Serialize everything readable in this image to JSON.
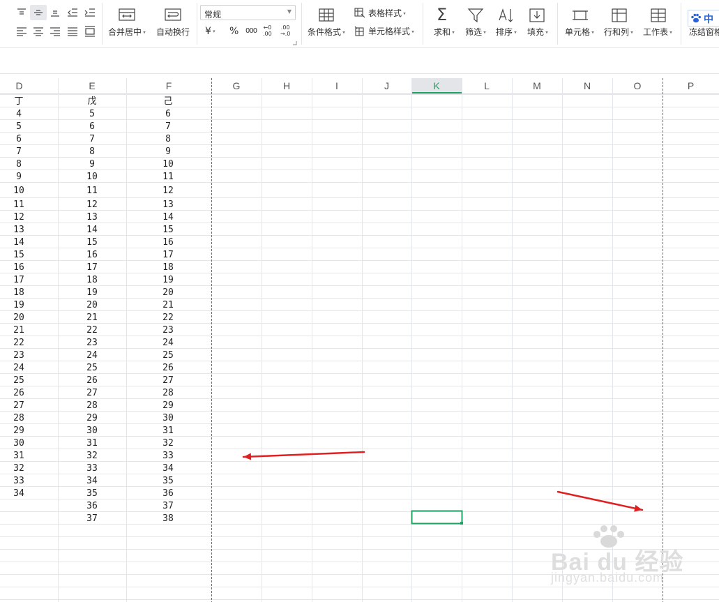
{
  "ribbon": {
    "merge_center": "合并居中",
    "auto_wrap": "自动换行",
    "number_format": "常规",
    "currency": "¥",
    "percent": "%",
    "thousands": "000",
    "decrease_decimal_top": "←0",
    "decrease_decimal_bottom": ".00",
    "increase_decimal_top": ".00",
    "increase_decimal_bottom": "→.0",
    "conditional_format": "条件格式",
    "table_style": "表格样式",
    "cell_style": "单元格样式",
    "sum": "求和",
    "filter": "筛选",
    "sort": "排序",
    "fill": "填充",
    "cell": "单元格",
    "rows_cols": "行和列",
    "worksheet": "工作表",
    "freeze_panes": "冻结窗格",
    "ime_badge": "中"
  },
  "grid": {
    "columns": [
      "D",
      "E",
      "F",
      "G",
      "H",
      "I",
      "J",
      "K",
      "L",
      "M",
      "N",
      "O",
      "P"
    ],
    "selected_column": "K",
    "header_row": [
      "丁",
      "戊",
      "己"
    ],
    "rows": [
      [
        "4",
        "5",
        "6"
      ],
      [
        "5",
        "6",
        "7"
      ],
      [
        "6",
        "7",
        "8"
      ],
      [
        "7",
        "8",
        "9"
      ],
      [
        "8",
        "9",
        "10"
      ],
      [
        "9",
        "10",
        "11"
      ],
      [
        "10",
        "11",
        "12"
      ],
      [
        "11",
        "12",
        "13"
      ],
      [
        "12",
        "13",
        "14"
      ],
      [
        "13",
        "14",
        "15"
      ],
      [
        "14",
        "15",
        "16"
      ],
      [
        "15",
        "16",
        "17"
      ],
      [
        "16",
        "17",
        "18"
      ],
      [
        "17",
        "18",
        "19"
      ],
      [
        "18",
        "19",
        "20"
      ],
      [
        "19",
        "20",
        "21"
      ],
      [
        "20",
        "21",
        "22"
      ],
      [
        "21",
        "22",
        "23"
      ],
      [
        "22",
        "23",
        "24"
      ],
      [
        "23",
        "24",
        "25"
      ],
      [
        "24",
        "25",
        "26"
      ],
      [
        "25",
        "26",
        "27"
      ],
      [
        "26",
        "27",
        "28"
      ],
      [
        "27",
        "28",
        "29"
      ],
      [
        "28",
        "29",
        "30"
      ],
      [
        "29",
        "30",
        "31"
      ],
      [
        "30",
        "31",
        "32"
      ],
      [
        "31",
        "32",
        "33"
      ],
      [
        "32",
        "33",
        "34"
      ],
      [
        "33",
        "34",
        "35"
      ],
      [
        "34",
        "35",
        "36"
      ],
      [
        "",
        "36",
        "37"
      ],
      [
        "",
        "37",
        "38"
      ]
    ]
  },
  "watermark": {
    "brand": "Bai du 经验",
    "url": "jingyan.baidu.com"
  },
  "colors": {
    "accent": "#21a366",
    "annotation": "#e02020",
    "header_selected_bg": "#e3e5e8",
    "gridline": "#e3e6ea"
  }
}
